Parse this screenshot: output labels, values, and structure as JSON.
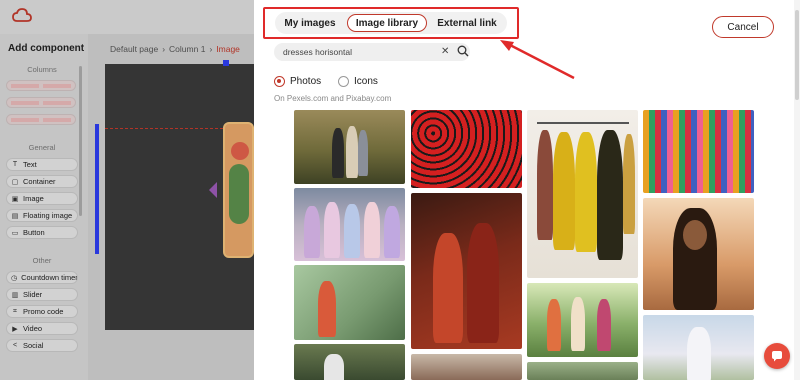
{
  "editor": {
    "sidebar_title": "Add component",
    "sections": {
      "columns": "Columns",
      "general": "General",
      "other": "Other"
    },
    "general_items": [
      {
        "label": "Text",
        "icon": "text-icon"
      },
      {
        "label": "Container",
        "icon": "container-icon"
      },
      {
        "label": "Image",
        "icon": "image-icon"
      },
      {
        "label": "Floating image",
        "icon": "floating-image-icon"
      },
      {
        "label": "Button",
        "icon": "button-icon"
      }
    ],
    "other_items": [
      {
        "label": "Countdown timer",
        "icon": "clock-icon"
      },
      {
        "label": "Slider",
        "icon": "slider-icon"
      },
      {
        "label": "Promo code",
        "icon": "tag-icon"
      },
      {
        "label": "Video",
        "icon": "play-icon"
      },
      {
        "label": "Social",
        "icon": "share-icon"
      }
    ],
    "breadcrumb": [
      "Default page",
      "Column 1",
      "Image"
    ]
  },
  "modal": {
    "tabs": [
      {
        "label": "My images",
        "active": false
      },
      {
        "label": "Image library",
        "active": true
      },
      {
        "label": "External link",
        "active": false
      }
    ],
    "cancel_label": "Cancel",
    "search": {
      "value": "dresses horisontal",
      "placeholder": ""
    },
    "radio_photos": "Photos",
    "radio_icons": "Icons",
    "selected_radio": "Photos",
    "source_text": "On Pexels.com and Pixabay.com"
  },
  "colors": {
    "accent": "#c0392b",
    "highlight": "#e02a2a",
    "chat": "#e74c3c"
  }
}
